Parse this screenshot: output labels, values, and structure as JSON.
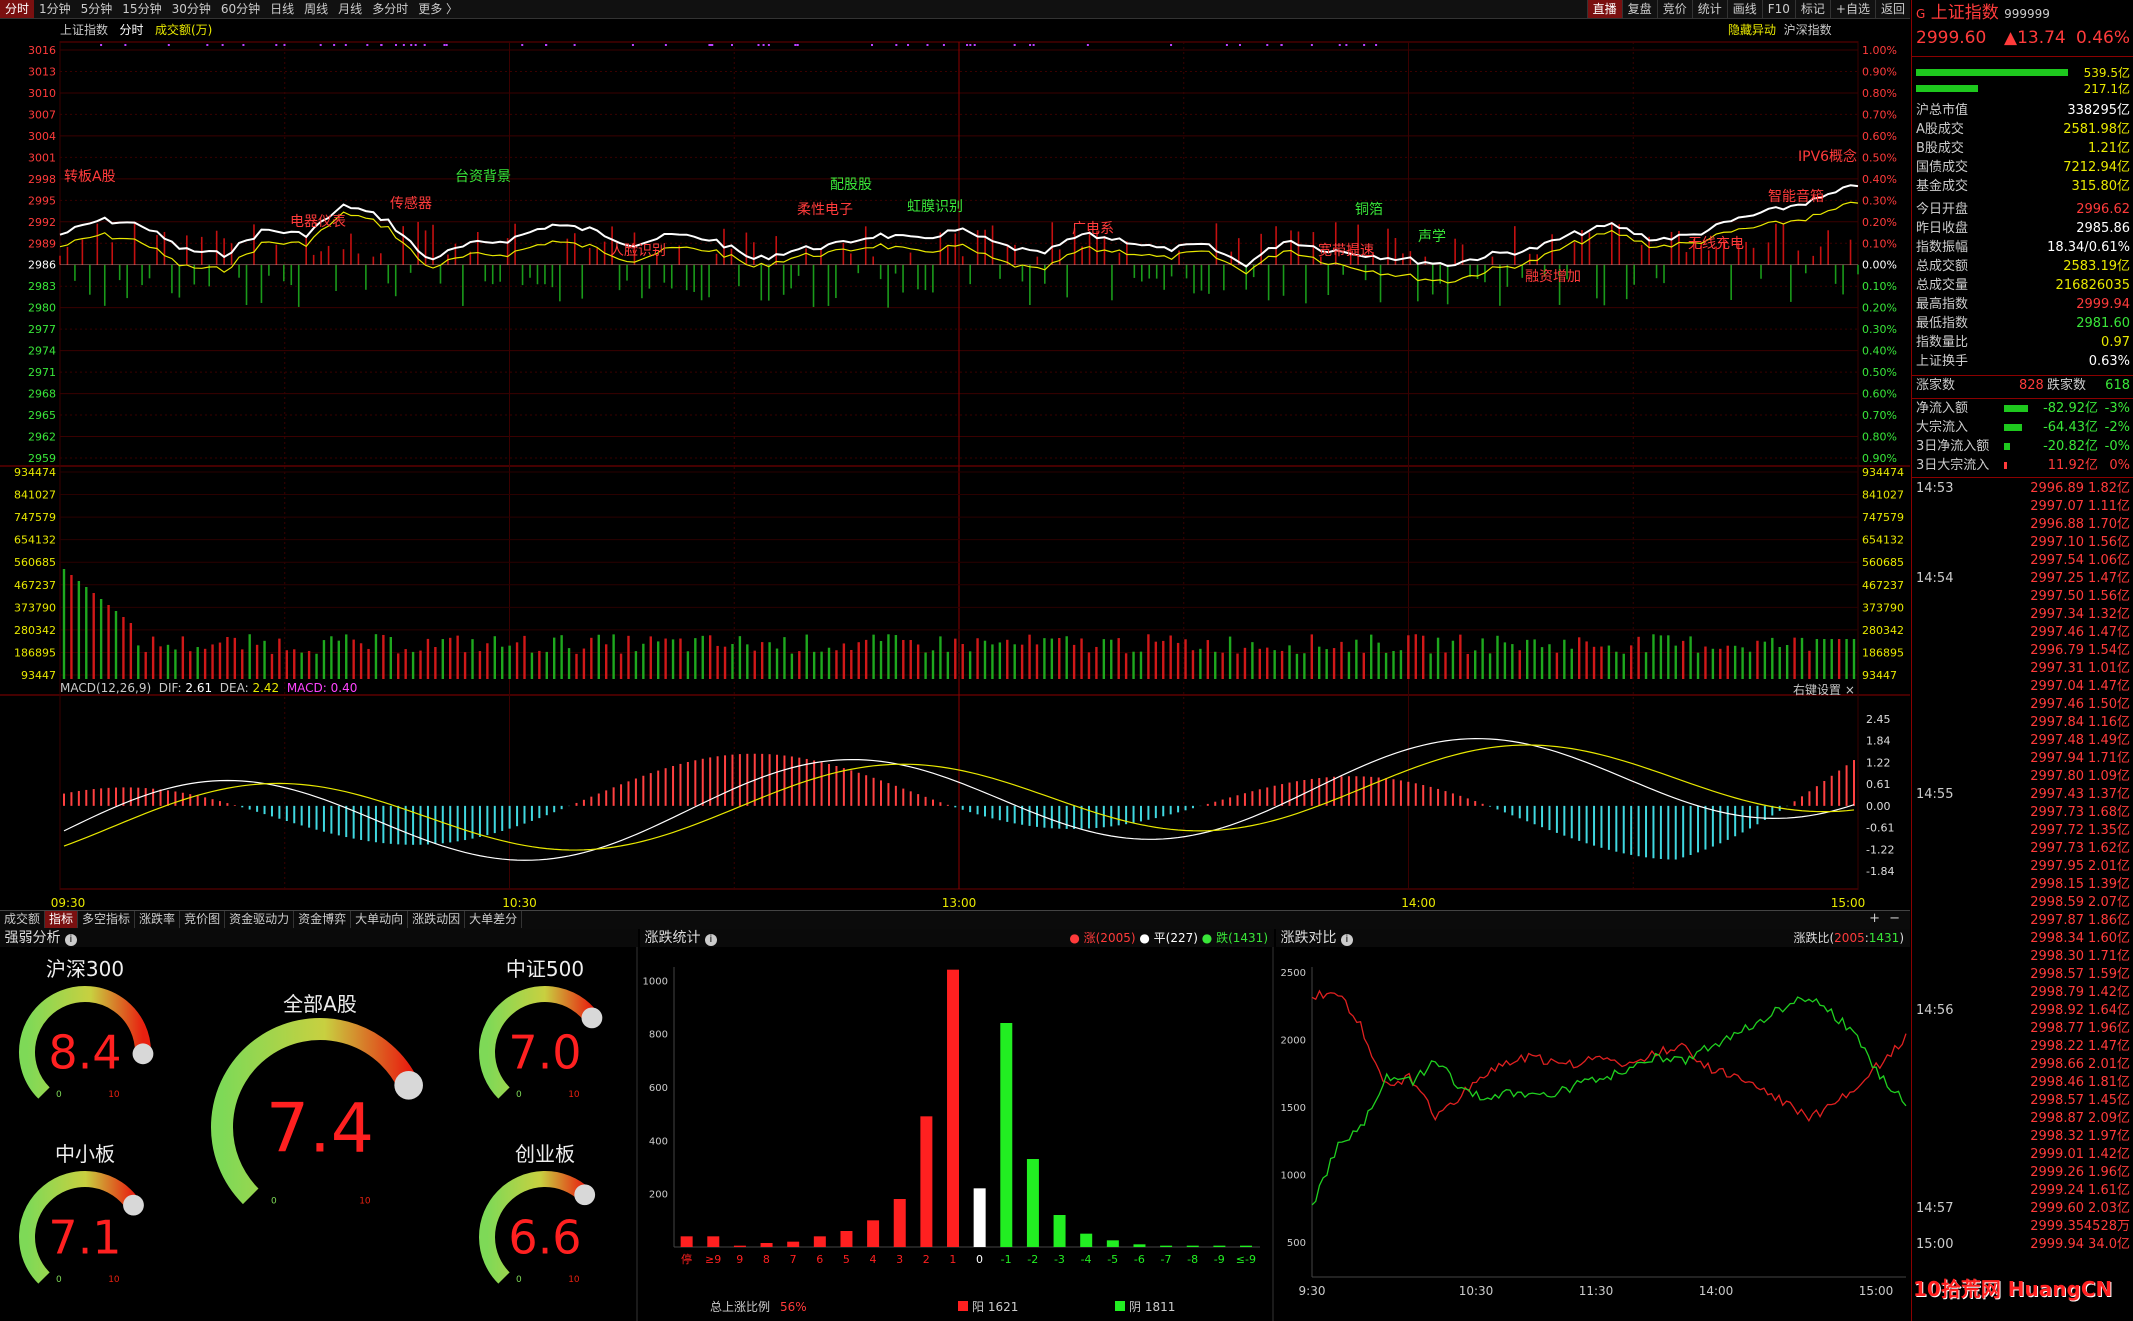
{
  "toolbar": {
    "tabs": [
      "分时",
      "1分钟",
      "5分钟",
      "15分钟",
      "30分钟",
      "60分钟",
      "日线",
      "周线",
      "月线",
      "多分时",
      "更多 〉"
    ],
    "right": [
      "直播",
      "复盘",
      "竞价",
      "统计",
      "画线",
      "F10",
      "标记",
      "+自选",
      "返回"
    ]
  },
  "chart_header": {
    "index_name": "上证指数",
    "mode": "分时",
    "volume_label": "成交额(万)",
    "right_links": [
      "隐藏异动",
      "沪深指数"
    ]
  },
  "price_axis": {
    "left": [
      "3016",
      "3013",
      "3010",
      "3007",
      "3004",
      "3001",
      "2998",
      "2995",
      "2992",
      "2989",
      "2986",
      "2983",
      "2980",
      "2977",
      "2974",
      "2971",
      "2968",
      "2965",
      "2962",
      "2959"
    ],
    "right": [
      "1.00%",
      "0.90%",
      "0.80%",
      "0.70%",
      "0.60%",
      "0.50%",
      "0.40%",
      "0.30%",
      "0.20%",
      "0.10%",
      "0.00%",
      "0.10%",
      "0.20%",
      "0.30%",
      "0.40%",
      "0.50%",
      "0.60%",
      "0.70%",
      "0.80%",
      "0.90%"
    ]
  },
  "volume_axis": [
    "934474",
    "841027",
    "747579",
    "654132",
    "560685",
    "467237",
    "373790",
    "280342",
    "186895",
    "93447"
  ],
  "macd": {
    "label": "MACD(12,26,9)",
    "dif_label": "DIF:",
    "dif": "2.61",
    "dea_label": "DEA:",
    "dea": "2.42",
    "macd_label": "MACD:",
    "macd_val": "0.40",
    "settings": "右键设置",
    "axis": [
      "2.45",
      "1.84",
      "1.22",
      "0.61",
      "0.00",
      "-0.61",
      "-1.22",
      "-1.84"
    ]
  },
  "time_axis": [
    "09:30",
    "10:30",
    "13:00",
    "14:00",
    "15:00"
  ],
  "annotations": [
    {
      "text": "转板A股",
      "color": "red"
    },
    {
      "text": "电器仪表",
      "color": "red"
    },
    {
      "text": "传感器",
      "color": "red"
    },
    {
      "text": "台资背景",
      "color": "green"
    },
    {
      "text": "人脸识别",
      "color": "red"
    },
    {
      "text": "配股股",
      "color": "green"
    },
    {
      "text": "柔性电子",
      "color": "red"
    },
    {
      "text": "虹膜识别",
      "color": "green"
    },
    {
      "text": "广电系",
      "color": "red"
    },
    {
      "text": "铜箔",
      "color": "green"
    },
    {
      "text": "宽带提速",
      "color": "red"
    },
    {
      "text": "声学",
      "color": "green"
    },
    {
      "text": "融资增加",
      "color": "red"
    },
    {
      "text": "无线充电",
      "color": "red"
    },
    {
      "text": "智能音箱",
      "color": "red"
    },
    {
      "text": "IPV6概念",
      "color": "red"
    }
  ],
  "bottom_tabs": [
    "成交额",
    "指标",
    "多空指标",
    "涨跌率",
    "竞价图",
    "资金驱动力",
    "资金博弈",
    "大单动向",
    "涨跌动因",
    "大单差分"
  ],
  "strength": {
    "title": "强弱分析",
    "gauges": [
      {
        "name": "沪深300",
        "value": "8.4",
        "min": "0",
        "max": "10",
        "level": 0.84
      },
      {
        "name": "中证500",
        "value": "7.0",
        "min": "0",
        "max": "10",
        "level": 0.7
      },
      {
        "name": "全部A股",
        "value": "7.4",
        "min": "0",
        "max": "10",
        "level": 0.74
      },
      {
        "name": "中小板",
        "value": "7.1",
        "min": "0",
        "max": "10",
        "level": 0.71
      },
      {
        "name": "创业板",
        "value": "6.6",
        "min": "0",
        "max": "10",
        "level": 0.66
      }
    ]
  },
  "stats": {
    "title": "涨跌统计",
    "legend": [
      {
        "text": "涨(2005)",
        "color": "#ff3b3b"
      },
      {
        "text": "平(227)",
        "color": "#ffffff"
      },
      {
        "text": "跌(1431)",
        "color": "#39e639"
      }
    ],
    "yaxis": [
      "1000",
      "800",
      "600",
      "400",
      "200"
    ],
    "categories": [
      "停",
      "≥9",
      "9",
      "8",
      "7",
      "6",
      "5",
      "4",
      "3",
      "2",
      "1",
      "0",
      "-1",
      "-2",
      "-3",
      "-4",
      "-5",
      "-6",
      "-7",
      "-8",
      "-9",
      "≤-9"
    ],
    "values": [
      40,
      40,
      5,
      15,
      20,
      40,
      60,
      100,
      180,
      490,
      1040,
      220,
      840,
      330,
      120,
      50,
      25,
      10,
      5,
      5,
      5,
      5
    ],
    "footer_label": "总上涨比例",
    "footer_pct": "56%",
    "yang": "阳 1621",
    "yin": "阴 1811"
  },
  "compare": {
    "title": "涨跌对比",
    "ratio_label": "涨跌比(",
    "ratio_up": "2005",
    "ratio_sep": ":",
    "ratio_down": "1431",
    "ratio_end": ")",
    "yaxis": [
      "2500",
      "2000",
      "1500",
      "1000",
      "500"
    ],
    "xaxis": [
      "9:30",
      "10:30",
      "11:30",
      "14:00",
      "15:00"
    ]
  },
  "quote": {
    "tag": "G",
    "name": "上证指数",
    "code": "999999",
    "price": "2999.60",
    "change": "▲13.74",
    "pct": "0.46%",
    "bars": [
      "539.5亿",
      "217.1亿"
    ]
  },
  "stats_rows": [
    {
      "label": "沪总市值",
      "value": "338295亿",
      "color": "white"
    },
    {
      "label": "A股成交",
      "value": "2581.98亿",
      "color": "yellow"
    },
    {
      "label": "B股成交",
      "value": "1.21亿",
      "color": "yellow"
    },
    {
      "label": "国债成交",
      "value": "7212.94亿",
      "color": "yellow"
    },
    {
      "label": "基金成交",
      "value": "315.80亿",
      "color": "yellow"
    },
    {
      "label": "今日开盘",
      "value": "2996.62",
      "color": "red"
    },
    {
      "label": "昨日收盘",
      "value": "2985.86",
      "color": "white"
    },
    {
      "label": "指数振幅",
      "value": "18.34/0.61%",
      "color": "white"
    },
    {
      "label": "总成交额",
      "value": "2583.19亿",
      "color": "yellow"
    },
    {
      "label": "总成交量",
      "value": "216826035",
      "color": "yellow"
    },
    {
      "label": "最高指数",
      "value": "2999.94",
      "color": "red"
    },
    {
      "label": "最低指数",
      "value": "2981.60",
      "color": "green"
    },
    {
      "label": "指数量比",
      "value": "0.97",
      "color": "yellow"
    },
    {
      "label": "上证换手",
      "value": "0.63%",
      "color": "white"
    }
  ],
  "updown": {
    "up_label": "涨家数",
    "up": "828",
    "down_label": "跌家数",
    "down": "618"
  },
  "flows": [
    {
      "label": "净流入额",
      "value": "-82.92亿",
      "pct": "-3%",
      "color": "green"
    },
    {
      "label": "大宗流入",
      "value": "-64.43亿",
      "pct": "-2%",
      "color": "green"
    },
    {
      "label": "3日净流入额",
      "value": "-20.82亿",
      "pct": "-0%",
      "color": "green"
    },
    {
      "label": "3日大宗流入",
      "value": "11.92亿",
      "pct": "0%",
      "color": "red"
    }
  ],
  "ticks": [
    {
      "t": "14:53",
      "p": "2996.89",
      "v": "1.82亿"
    },
    {
      "t": "",
      "p": "2997.07",
      "v": "1.11亿"
    },
    {
      "t": "",
      "p": "2996.88",
      "v": "1.70亿"
    },
    {
      "t": "",
      "p": "2997.10",
      "v": "1.56亿"
    },
    {
      "t": "",
      "p": "2997.54",
      "v": "1.06亿"
    },
    {
      "t": "14:54",
      "p": "2997.25",
      "v": "1.47亿"
    },
    {
      "t": "",
      "p": "2997.50",
      "v": "1.56亿"
    },
    {
      "t": "",
      "p": "2997.34",
      "v": "1.32亿"
    },
    {
      "t": "",
      "p": "2997.46",
      "v": "1.47亿"
    },
    {
      "t": "",
      "p": "2996.79",
      "v": "1.54亿"
    },
    {
      "t": "",
      "p": "2997.31",
      "v": "1.01亿"
    },
    {
      "t": "",
      "p": "2997.04",
      "v": "1.47亿"
    },
    {
      "t": "",
      "p": "2997.46",
      "v": "1.50亿"
    },
    {
      "t": "",
      "p": "2997.84",
      "v": "1.16亿"
    },
    {
      "t": "",
      "p": "2997.48",
      "v": "1.49亿"
    },
    {
      "t": "",
      "p": "2997.94",
      "v": "1.71亿"
    },
    {
      "t": "",
      "p": "2997.80",
      "v": "1.09亿"
    },
    {
      "t": "14:55",
      "p": "2997.43",
      "v": "1.37亿"
    },
    {
      "t": "",
      "p": "2997.73",
      "v": "1.68亿"
    },
    {
      "t": "",
      "p": "2997.72",
      "v": "1.35亿"
    },
    {
      "t": "",
      "p": "2997.73",
      "v": "1.62亿"
    },
    {
      "t": "",
      "p": "2997.95",
      "v": "2.01亿"
    },
    {
      "t": "",
      "p": "2998.15",
      "v": "1.39亿"
    },
    {
      "t": "",
      "p": "2998.59",
      "v": "2.07亿"
    },
    {
      "t": "",
      "p": "2997.87",
      "v": "1.86亿"
    },
    {
      "t": "",
      "p": "2998.34",
      "v": "1.60亿"
    },
    {
      "t": "",
      "p": "2998.30",
      "v": "1.71亿"
    },
    {
      "t": "",
      "p": "2998.57",
      "v": "1.59亿"
    },
    {
      "t": "",
      "p": "2998.79",
      "v": "1.42亿"
    },
    {
      "t": "14:56",
      "p": "2998.92",
      "v": "1.64亿"
    },
    {
      "t": "",
      "p": "2998.77",
      "v": "1.96亿"
    },
    {
      "t": "",
      "p": "2998.22",
      "v": "1.47亿"
    },
    {
      "t": "",
      "p": "2998.66",
      "v": "2.01亿"
    },
    {
      "t": "",
      "p": "2998.46",
      "v": "1.81亿"
    },
    {
      "t": "",
      "p": "2998.57",
      "v": "1.45亿"
    },
    {
      "t": "",
      "p": "2998.87",
      "v": "2.09亿"
    },
    {
      "t": "",
      "p": "2998.32",
      "v": "1.97亿"
    },
    {
      "t": "",
      "p": "2999.01",
      "v": "1.42亿"
    },
    {
      "t": "",
      "p": "2999.26",
      "v": "1.96亿"
    },
    {
      "t": "",
      "p": "2999.24",
      "v": "1.61亿"
    },
    {
      "t": "14:57",
      "p": "2999.60",
      "v": "2.03亿"
    },
    {
      "t": "",
      "p": "2999.35",
      "v": "4528万"
    },
    {
      "t": "15:00",
      "p": "2999.94",
      "v": "34.0亿"
    }
  ],
  "watermark": "10拾荒网 HuangCN",
  "colors": {
    "up": "#ff3b3b",
    "down": "#39e639",
    "flat": "#ffffff",
    "dif": "#ffffff",
    "dea": "#e8e800",
    "grid": "#5a0000"
  }
}
